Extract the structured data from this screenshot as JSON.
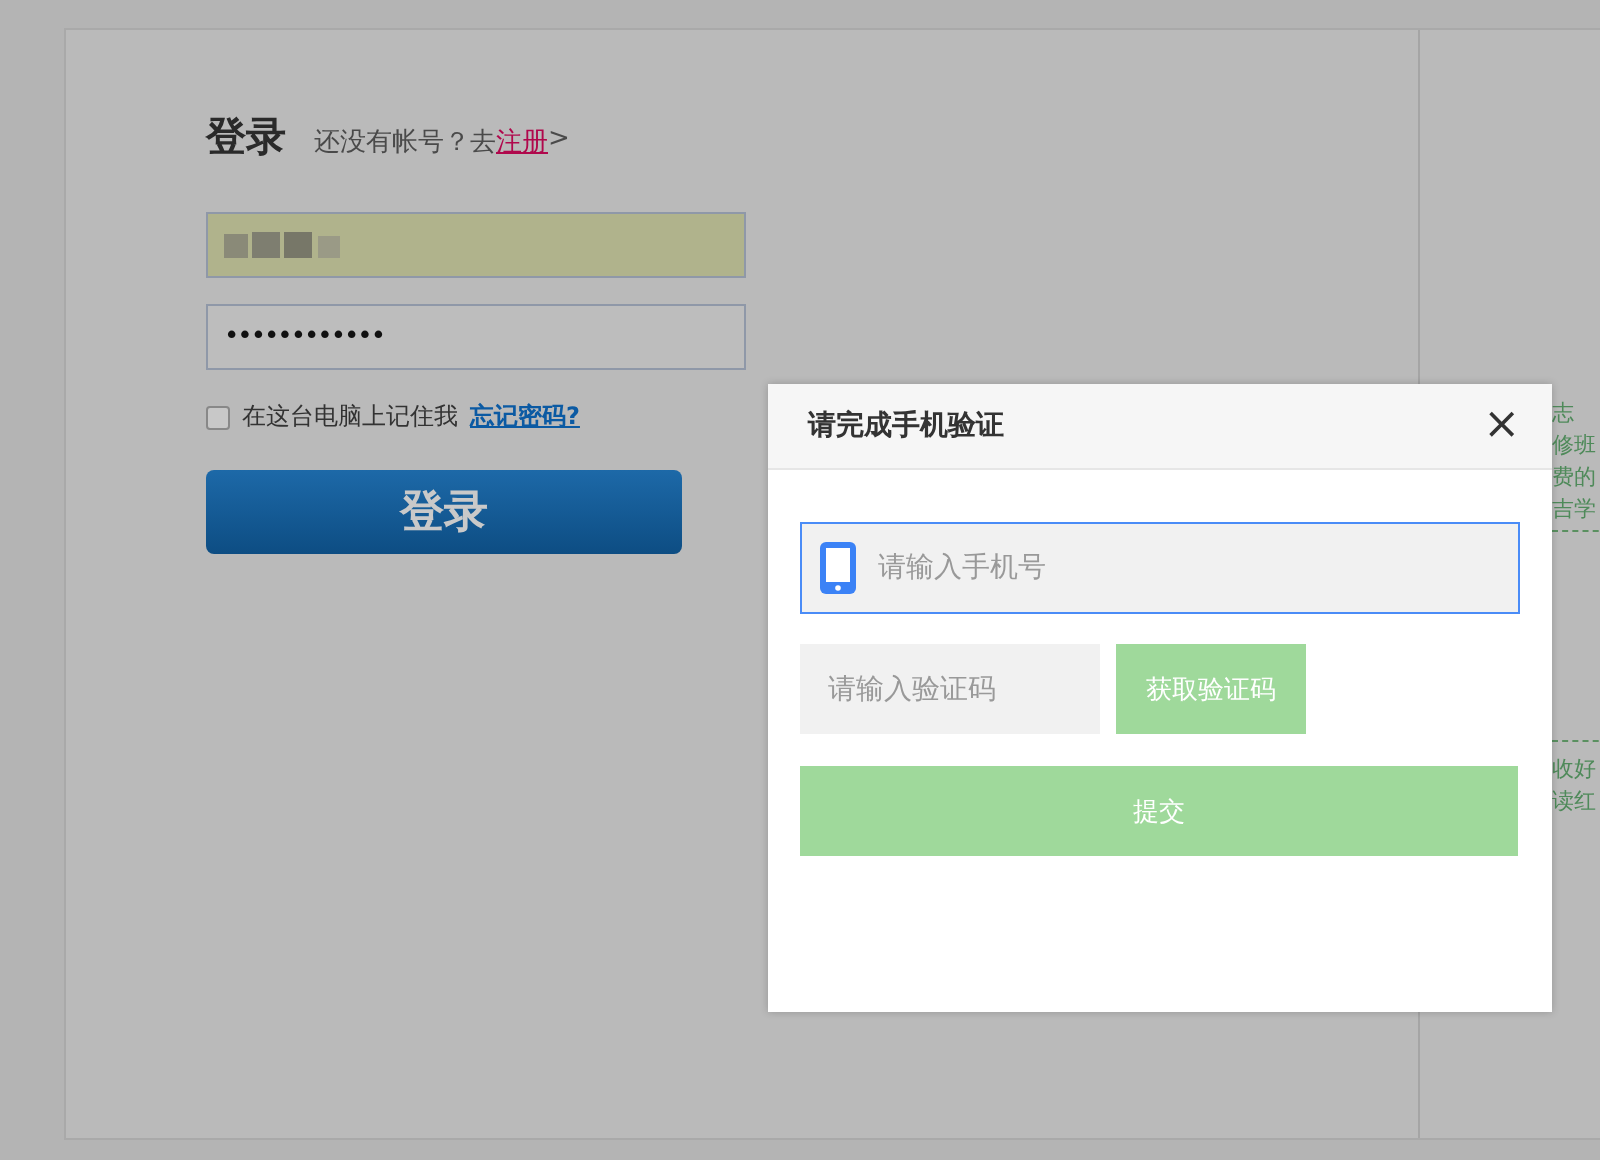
{
  "login": {
    "title": "登录",
    "register_prompt": "还没有帐号？去",
    "register_link": "注册",
    "register_arrow": ">",
    "password_value": "••••••••••••",
    "remember_label": "在这台电脑上记住我",
    "remember_checked": false,
    "forgot_link": "忘记密码?",
    "login_button": "登录"
  },
  "side_fragments": [
    [
      "志",
      "修班",
      "费的",
      "吉学"
    ],
    [
      "收好",
      "读红"
    ]
  ],
  "dialog": {
    "title": "请完成手机验证",
    "close": "×",
    "phone_placeholder": "请输入手机号",
    "code_placeholder": "请输入验证码",
    "get_code_button": "获取验证码",
    "submit_button": "提交"
  }
}
